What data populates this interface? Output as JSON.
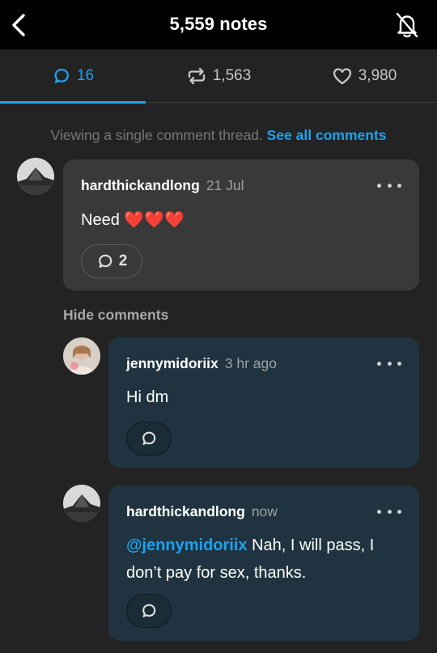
{
  "header": {
    "title": "5,559 notes",
    "back_icon": "chevron-left-icon",
    "bell_icon": "bell-off-icon"
  },
  "tabs": [
    {
      "label": "16",
      "icon": "comment-icon",
      "active": true
    },
    {
      "label": "1,563",
      "icon": "reblog-icon",
      "active": false
    },
    {
      "label": "3,980",
      "icon": "heart-icon",
      "active": false
    }
  ],
  "thread_note": {
    "text": "Viewing a single comment thread.",
    "link": "See all comments"
  },
  "hide_comments_label": "Hide comments",
  "comments": [
    {
      "username": "hardthickandlong",
      "time": "21 Jul",
      "text": "Need",
      "emoji": "❤️❤️❤️",
      "reply_count": "2"
    },
    {
      "username": "jennymidoriix",
      "time": "3 hr ago",
      "text": "Hi dm"
    },
    {
      "username": "hardthickandlong",
      "time": "now",
      "mention": "@jennymidoriix",
      "text_line1": " Nah, I will pass, I",
      "text_line2": "don’t pay for sex, thanks."
    }
  ],
  "colors": {
    "accent": "#1ea1ee",
    "background": "#232323",
    "topbar": "#000000",
    "card_dark": "#393939",
    "card_teal": "#1f3440"
  }
}
